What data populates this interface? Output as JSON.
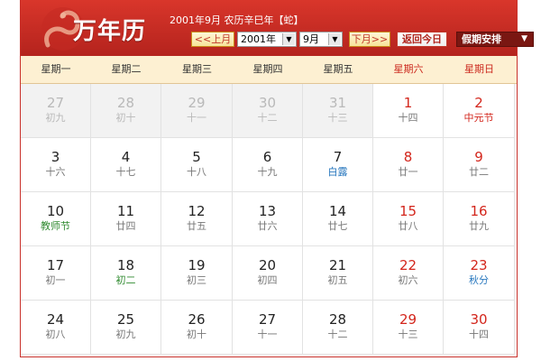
{
  "header": {
    "brand": "万年历",
    "info": "2001年9月 农历辛巳年【蛇】",
    "prev_month_label": "<<上月",
    "year_value": "2001年",
    "month_value": "9月",
    "next_month_label": "下月>>",
    "today_label": "返回今日",
    "holiday_label": "假期安排",
    "colors": {
      "header_red": "#c9312b",
      "weekend_red": "#d3261c",
      "solar_term_blue": "#2b79bf"
    }
  },
  "weekdays": [
    {
      "label": "星期一",
      "weekend": false
    },
    {
      "label": "星期二",
      "weekend": false
    },
    {
      "label": "星期三",
      "weekend": false
    },
    {
      "label": "星期四",
      "weekend": false
    },
    {
      "label": "星期五",
      "weekend": false
    },
    {
      "label": "星期六",
      "weekend": true
    },
    {
      "label": "星期日",
      "weekend": true
    }
  ],
  "weeks": [
    [
      {
        "day": "27",
        "lunar": "初九",
        "other": true
      },
      {
        "day": "28",
        "lunar": "初十",
        "other": true
      },
      {
        "day": "29",
        "lunar": "十一",
        "other": true
      },
      {
        "day": "30",
        "lunar": "十二",
        "other": true
      },
      {
        "day": "31",
        "lunar": "十三",
        "other": true
      },
      {
        "day": "1",
        "lunar": "十四"
      },
      {
        "day": "2",
        "lunar": "中元节",
        "tag": "red"
      }
    ],
    [
      {
        "day": "3",
        "lunar": "十六"
      },
      {
        "day": "4",
        "lunar": "十七"
      },
      {
        "day": "5",
        "lunar": "十八"
      },
      {
        "day": "6",
        "lunar": "十九"
      },
      {
        "day": "7",
        "lunar": "白露",
        "tag": "blue"
      },
      {
        "day": "8",
        "lunar": "廿一"
      },
      {
        "day": "9",
        "lunar": "廿二"
      }
    ],
    [
      {
        "day": "10",
        "lunar": "教师节",
        "tag": "green"
      },
      {
        "day": "11",
        "lunar": "廿四"
      },
      {
        "day": "12",
        "lunar": "廿五"
      },
      {
        "day": "13",
        "lunar": "廿六"
      },
      {
        "day": "14",
        "lunar": "廿七"
      },
      {
        "day": "15",
        "lunar": "廿八"
      },
      {
        "day": "16",
        "lunar": "廿九"
      }
    ],
    [
      {
        "day": "17",
        "lunar": "初一"
      },
      {
        "day": "18",
        "lunar": "初二",
        "tag": "green"
      },
      {
        "day": "19",
        "lunar": "初三"
      },
      {
        "day": "20",
        "lunar": "初四"
      },
      {
        "day": "21",
        "lunar": "初五"
      },
      {
        "day": "22",
        "lunar": "初六"
      },
      {
        "day": "23",
        "lunar": "秋分",
        "tag": "blue"
      }
    ],
    [
      {
        "day": "24",
        "lunar": "初八"
      },
      {
        "day": "25",
        "lunar": "初九"
      },
      {
        "day": "26",
        "lunar": "初十"
      },
      {
        "day": "27",
        "lunar": "十一"
      },
      {
        "day": "28",
        "lunar": "十二"
      },
      {
        "day": "29",
        "lunar": "十三"
      },
      {
        "day": "30",
        "lunar": "十四"
      }
    ]
  ]
}
